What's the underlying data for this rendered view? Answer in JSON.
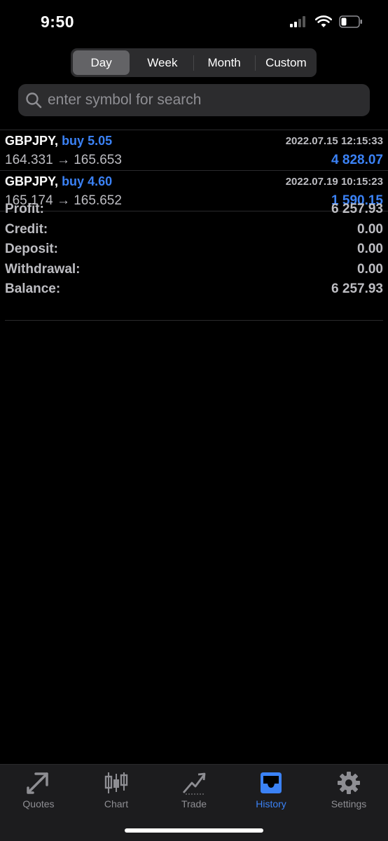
{
  "status": {
    "time": "9:50"
  },
  "periods": {
    "items": [
      "Day",
      "Week",
      "Month",
      "Custom"
    ],
    "active": "Day"
  },
  "search": {
    "placeholder": "enter symbol for search"
  },
  "deals": [
    {
      "symbol": "GBPJPY,",
      "side": "buy 5.05",
      "datetime": "2022.07.15 12:15:33",
      "prices": "164.331 → 165.653",
      "profit": "4 828.07"
    },
    {
      "symbol": "GBPJPY,",
      "side": "buy 4.60",
      "datetime": "2022.07.19 10:15:23",
      "prices": "165.174 → 165.652",
      "profit": "1 590.15"
    }
  ],
  "summary": {
    "profit": {
      "label": "Profit:",
      "value": "6 257.93"
    },
    "credit": {
      "label": "Credit:",
      "value": "0.00"
    },
    "deposit": {
      "label": "Deposit:",
      "value": "0.00"
    },
    "withdrawal": {
      "label": "Withdrawal:",
      "value": "0.00"
    },
    "balance": {
      "label": "Balance:",
      "value": "6 257.93"
    }
  },
  "tabbar": {
    "quotes": "Quotes",
    "chart": "Chart",
    "trade": "Trade",
    "history": "History",
    "settings": "Settings",
    "active": "History",
    "accent": "#3b82f6"
  }
}
